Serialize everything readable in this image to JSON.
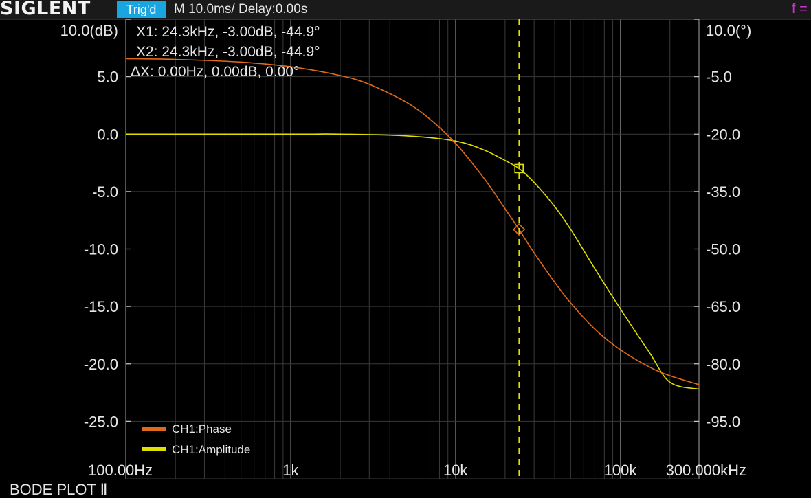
{
  "topbar": {
    "logo": "SIGLENT",
    "trigger_status": "Trig'd",
    "timebase": "M 10.0ms/ Delay:0.00s",
    "corner_label": "f ="
  },
  "cursor_readout": {
    "x1": "X1: 24.3kHz, -3.00dB, -44.9°",
    "x2": "X2: 24.3kHz, -3.00dB, -44.9°",
    "dx": "ΔX: 0.00Hz, 0.00dB, 0.00°"
  },
  "legend": [
    {
      "label": "CH1:Phase",
      "color": "#e06a1a"
    },
    {
      "label": "CH1:Amplitude",
      "color": "#e0e000"
    }
  ],
  "footer": {
    "mode_label": "BODE PLOT Ⅱ"
  },
  "chart_data": {
    "type": "line",
    "x_scale": "log",
    "x_range_hz": [
      100,
      300000
    ],
    "x_tick_labels": [
      {
        "value": 100,
        "label": "100.00Hz"
      },
      {
        "value": 1000,
        "label": "1k"
      },
      {
        "value": 10000,
        "label": "10k"
      },
      {
        "value": 100000,
        "label": "100k"
      },
      {
        "value": 300000,
        "label": "300.000kHz"
      }
    ],
    "left_axis": {
      "unit_label": "10.0(dB)",
      "range": [
        -30,
        10
      ],
      "ticks": [
        {
          "value": 10,
          "label": "10.0(dB)"
        },
        {
          "value": 5,
          "label": "5.0"
        },
        {
          "value": 0,
          "label": "0.0"
        },
        {
          "value": -5,
          "label": "-5.0"
        },
        {
          "value": -10,
          "label": "-10.0"
        },
        {
          "value": -15,
          "label": "-15.0"
        },
        {
          "value": -20,
          "label": "-20.0"
        },
        {
          "value": -25,
          "label": "-25.0"
        }
      ]
    },
    "right_axis": {
      "unit_label": "10.0(°)",
      "range": [
        -110,
        10
      ],
      "ticks": [
        {
          "value": 10,
          "label": "10.0(°)"
        },
        {
          "value": -5,
          "label": "-5.0"
        },
        {
          "value": -20,
          "label": "-20.0"
        },
        {
          "value": -35,
          "label": "-35.0"
        },
        {
          "value": -50,
          "label": "-50.0"
        },
        {
          "value": -65,
          "label": "-65.0"
        },
        {
          "value": -80,
          "label": "-80.0"
        },
        {
          "value": -95,
          "label": "-95.0"
        }
      ]
    },
    "grid": true,
    "cursor_frequency_hz": 24300,
    "series": [
      {
        "name": "CH1:Amplitude",
        "axis": "left",
        "color": "#e0e000",
        "points": [
          [
            100,
            0
          ],
          [
            1000,
            0
          ],
          [
            2000,
            0
          ],
          [
            5000,
            -0.15
          ],
          [
            10000,
            -0.6
          ],
          [
            15000,
            -1.4
          ],
          [
            20000,
            -2.3
          ],
          [
            24300,
            -3.0
          ],
          [
            30000,
            -4.2
          ],
          [
            40000,
            -6.3
          ],
          [
            50000,
            -8.3
          ],
          [
            70000,
            -11.7
          ],
          [
            100000,
            -15.2
          ],
          [
            150000,
            -19.0
          ],
          [
            200000,
            -21.6
          ],
          [
            300000,
            -22.2
          ]
        ]
      },
      {
        "name": "CH1:Phase",
        "axis": "right",
        "color": "#e06a1a",
        "points": [
          [
            100,
            -0.3
          ],
          [
            200,
            -0.5
          ],
          [
            500,
            -1.2
          ],
          [
            1000,
            -2.4
          ],
          [
            2000,
            -4.7
          ],
          [
            3000,
            -7.0
          ],
          [
            5000,
            -11.6
          ],
          [
            7000,
            -16.1
          ],
          [
            10000,
            -22.4
          ],
          [
            15000,
            -31.7
          ],
          [
            20000,
            -39.5
          ],
          [
            24300,
            -44.9
          ],
          [
            30000,
            -51.0
          ],
          [
            40000,
            -58.7
          ],
          [
            50000,
            -64.1
          ],
          [
            70000,
            -70.9
          ],
          [
            100000,
            -76.3
          ],
          [
            150000,
            -80.8
          ],
          [
            200000,
            -83.1
          ],
          [
            300000,
            -85.4
          ]
        ]
      }
    ],
    "markers": [
      {
        "series": "CH1:Amplitude",
        "shape": "square",
        "x": 24300,
        "y": -3.0
      },
      {
        "series": "CH1:Phase",
        "shape": "diamond",
        "x": 24300,
        "y": -44.9
      }
    ]
  }
}
